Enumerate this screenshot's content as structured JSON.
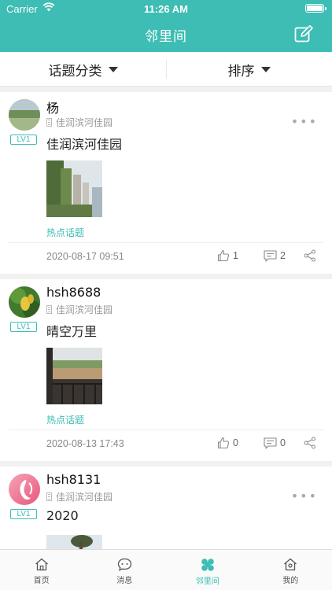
{
  "status": {
    "carrier": "Carrier",
    "time": "11:26 AM"
  },
  "nav": {
    "title": "邻里间",
    "compose_icon": "edit-icon"
  },
  "filters": {
    "category": "话题分类",
    "sort": "排序"
  },
  "posts": [
    {
      "username": "杨",
      "level": "LV1",
      "community": "佳润滨河佳园",
      "text": "佳润滨河佳园",
      "tag": "热点话题",
      "date": "2020-08-17 09:51",
      "likes": "1",
      "comments": "2"
    },
    {
      "username": "hsh8688",
      "level": "LV1",
      "community": "佳润滨河佳园",
      "text": "晴空万里",
      "tag": "热点话题",
      "date": "2020-08-13 17:43",
      "likes": "0",
      "comments": "0"
    },
    {
      "username": "hsh8131",
      "level": "LV1",
      "community": "佳润滨河佳园",
      "text": "2020"
    }
  ],
  "tabs": [
    {
      "label": "首页",
      "icon": "home-icon"
    },
    {
      "label": "消息",
      "icon": "message-icon"
    },
    {
      "label": "邻里间",
      "icon": "clover-icon",
      "active": true
    },
    {
      "label": "我的",
      "icon": "profile-icon"
    }
  ],
  "colors": {
    "accent": "#3dbdb3"
  }
}
